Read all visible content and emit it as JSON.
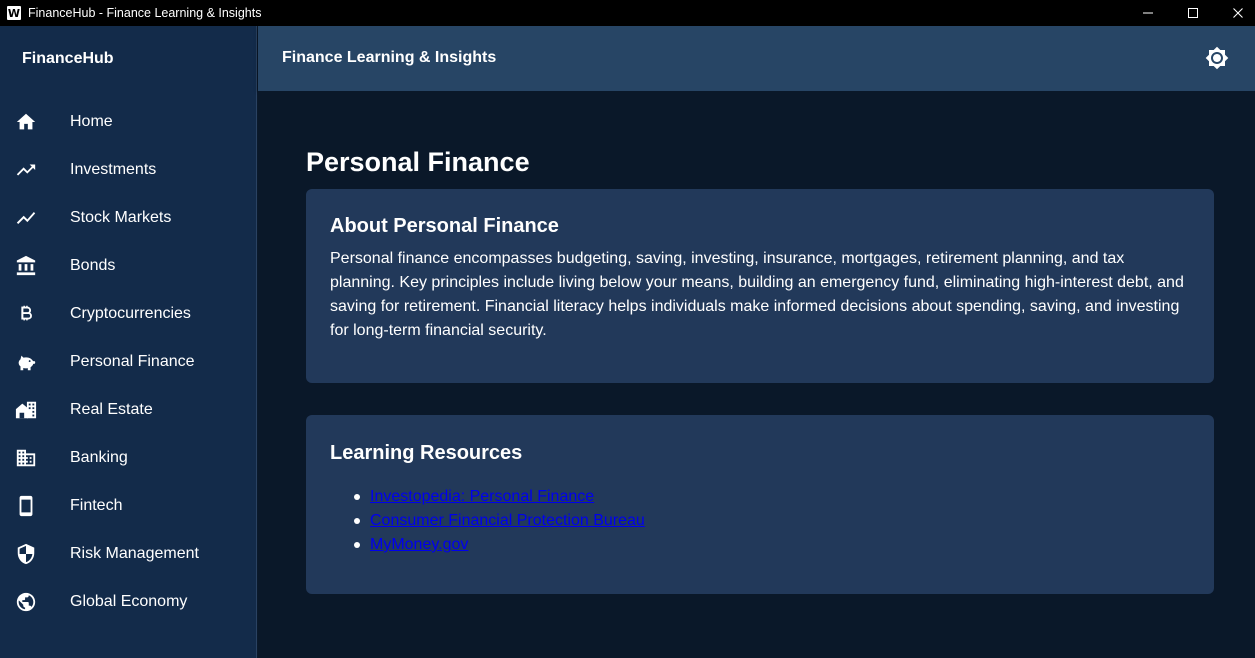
{
  "window": {
    "title": "FinanceHub - Finance Learning & Insights",
    "app_logo_glyph": "W"
  },
  "sidebar": {
    "brand": "FinanceHub",
    "items": [
      {
        "label": "Home",
        "icon": "home-icon"
      },
      {
        "label": "Investments",
        "icon": "trending-up-icon"
      },
      {
        "label": "Stock Markets",
        "icon": "line-chart-icon"
      },
      {
        "label": "Bonds",
        "icon": "bank-icon"
      },
      {
        "label": "Cryptocurrencies",
        "icon": "bitcoin-icon"
      },
      {
        "label": "Personal Finance",
        "icon": "piggy-bank-icon"
      },
      {
        "label": "Real Estate",
        "icon": "real-estate-icon"
      },
      {
        "label": "Banking",
        "icon": "building-icon"
      },
      {
        "label": "Fintech",
        "icon": "smartphone-icon"
      },
      {
        "label": "Risk Management",
        "icon": "shield-icon"
      },
      {
        "label": "Global Economy",
        "icon": "globe-icon"
      }
    ]
  },
  "header": {
    "title": "Finance Learning & Insights",
    "theme_icon": "brightness-icon"
  },
  "main": {
    "page_title": "Personal Finance",
    "about": {
      "title": "About Personal Finance",
      "text": "Personal finance encompasses budgeting, saving, investing, insurance, mortgages, retirement planning, and tax planning. Key principles include living below your means, building an emergency fund, eliminating high-interest debt, and saving for retirement. Financial literacy helps individuals make informed decisions about spending, saving, and investing for long-term financial security."
    },
    "resources": {
      "title": "Learning Resources",
      "links": [
        "Investopedia: Personal Finance",
        "Consumer Financial Protection Bureau",
        "MyMoney.gov"
      ]
    }
  },
  "colors": {
    "sidebar_bg": "#132b4a",
    "header_bg": "#274565",
    "main_bg": "#0a1829",
    "card_bg": "#22395a",
    "link": "#0000ee"
  }
}
